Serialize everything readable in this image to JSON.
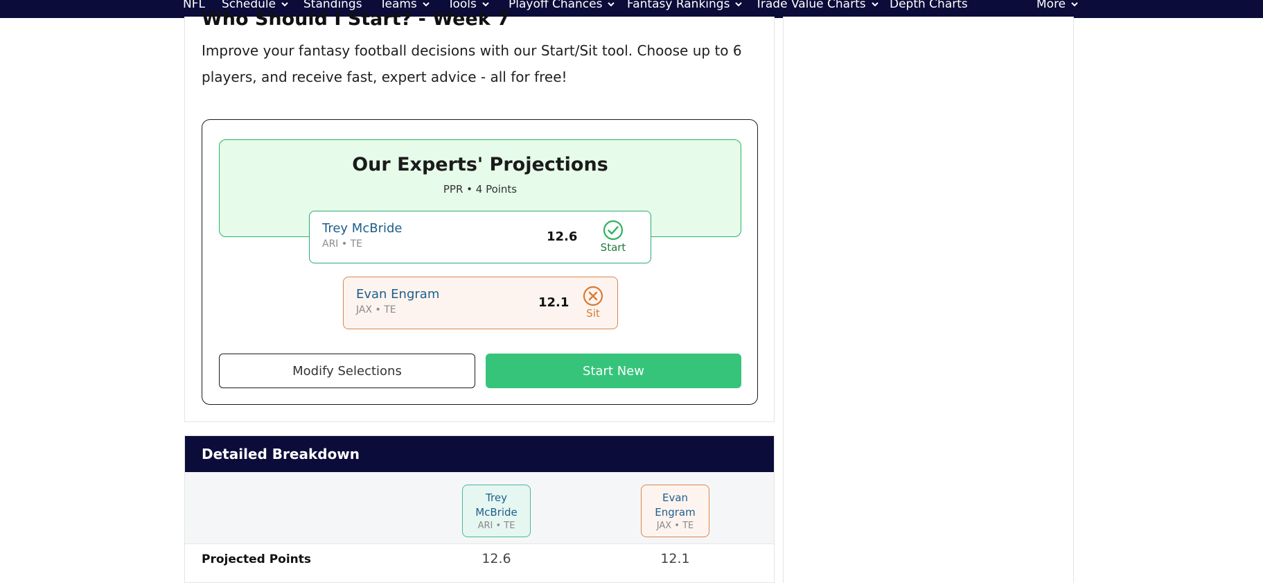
{
  "nav": {
    "items": [
      {
        "label": "NFL",
        "dropdown": false
      },
      {
        "label": "Schedule",
        "dropdown": true
      },
      {
        "label": "Standings",
        "dropdown": false
      },
      {
        "label": "Teams",
        "dropdown": true
      },
      {
        "label": "Tools",
        "dropdown": true
      },
      {
        "label": "Playoff Chances",
        "dropdown": true
      },
      {
        "label": "Fantasy Rankings",
        "dropdown": true
      },
      {
        "label": "Trade Value Charts",
        "dropdown": true
      },
      {
        "label": "Depth Charts",
        "dropdown": false
      },
      {
        "label": "More",
        "dropdown": true
      }
    ]
  },
  "page": {
    "title": "Who Should I Start? - Week 7",
    "intro": "Improve your fantasy football decisions with our Start/Sit tool. Choose up to 6 players, and receive fast, expert advice - all for free!"
  },
  "projections": {
    "title": "Our Experts' Projections",
    "subtitle": "PPR • 4 Points",
    "players": [
      {
        "name": "Trey McBride",
        "meta": "ARI • TE",
        "score": "12.6",
        "verdict": "Start"
      },
      {
        "name": "Evan Engram",
        "meta": "JAX • TE",
        "score": "12.1",
        "verdict": "Sit"
      }
    ]
  },
  "buttons": {
    "modify": "Modify Selections",
    "start_new": "Start New"
  },
  "breakdown": {
    "title": "Detailed Breakdown",
    "players": [
      {
        "name_line1": "Trey",
        "name_line2": "McBride",
        "meta": "ARI • TE"
      },
      {
        "name_line1": "Evan",
        "name_line2": "Engram",
        "meta": "JAX • TE"
      }
    ],
    "rows": [
      {
        "label": "Projected Points",
        "values": [
          "12.6",
          "12.1"
        ]
      }
    ]
  },
  "colors": {
    "nav_bg": "#0b0c3a",
    "start_green": "#2bb35e",
    "sit_orange": "#d97a35",
    "button_green": "#36c47a",
    "player_name_blue": "#1d5e8c"
  },
  "icons": {
    "start": "check-circle-icon",
    "sit": "x-circle-icon",
    "dropdown": "chevron-down-icon"
  }
}
